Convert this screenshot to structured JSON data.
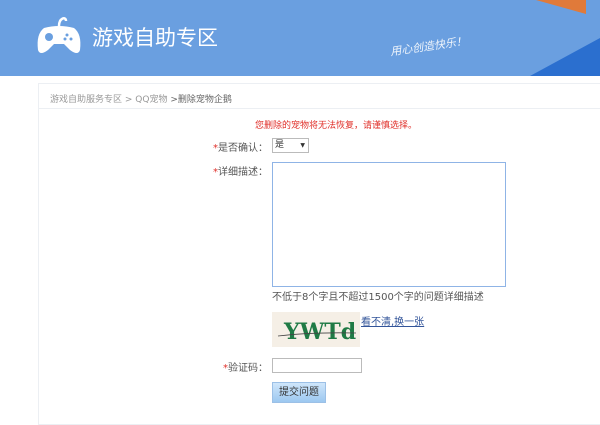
{
  "header": {
    "title": "游戏自助专区",
    "slogan": "用心创造快乐！",
    "logo_icon": "gamepad-icon",
    "accent": "#6a9fe0"
  },
  "breadcrumb": {
    "items": [
      "游戏自助服务专区",
      " > ",
      "QQ宠物",
      " >删除宠物企鹅"
    ]
  },
  "form": {
    "warning": "您删除的宠物将无法恢复，请谨慎选择。",
    "confirm_label": "是否确认：",
    "confirm_value": "是",
    "desc_label": "详细描述：",
    "desc_value": "",
    "desc_hint": "不低于8个字且不超过1500个字的问题详细描述",
    "captcha_text": "YWTd",
    "captcha_refresh": "看不清,换一张",
    "code_label": "验证码：",
    "code_value": "",
    "submit": "提交问题",
    "required_mark": "*"
  }
}
